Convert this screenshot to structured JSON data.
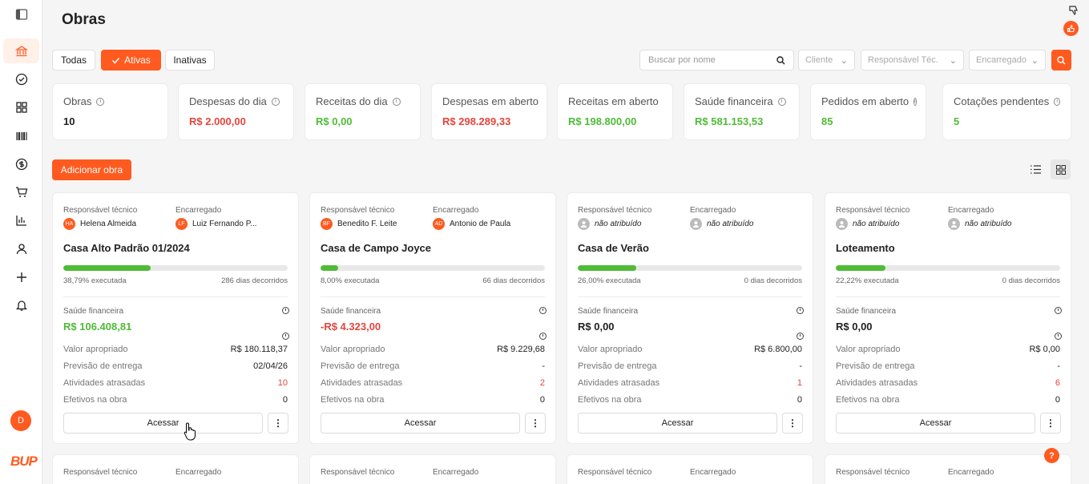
{
  "page": {
    "title": "Obras"
  },
  "colors": {
    "accent": "#ff5a1f",
    "positive": "#4fbb37",
    "negative": "#e4453c"
  },
  "sidebar": {
    "avatar_initial": "D",
    "logo": "BUP",
    "items": [
      {
        "icon": "bank-icon",
        "active": true
      },
      {
        "icon": "check-circle-icon"
      },
      {
        "icon": "grid-icon"
      },
      {
        "icon": "barcode-icon"
      },
      {
        "icon": "dollar-icon"
      },
      {
        "icon": "cart-icon"
      },
      {
        "icon": "bar-chart-icon"
      },
      {
        "icon": "user-icon"
      },
      {
        "icon": "plus-icon"
      },
      {
        "icon": "bell-icon"
      }
    ]
  },
  "filters": {
    "status": [
      "Todas",
      "Ativas",
      "Inativas"
    ],
    "selected": "Ativas",
    "search_placeholder": "Buscar por nome",
    "selects": [
      "Cliente",
      "Responsável Téc.",
      "Encarregado"
    ]
  },
  "stats": [
    {
      "label": "Obras",
      "value": "10",
      "tone": "dark",
      "info": true
    },
    {
      "label": "Despesas do dia",
      "value": "R$ 2.000,00",
      "tone": "red",
      "info": true
    },
    {
      "label": "Receitas do dia",
      "value": "R$ 0,00",
      "tone": "green",
      "info": true
    },
    {
      "label": "Despesas em aberto",
      "value": "R$ 298.289,33",
      "tone": "red",
      "info": false
    },
    {
      "label": "Receitas em aberto",
      "value": "R$ 198.800,00",
      "tone": "green",
      "info": false
    },
    {
      "label": "Saúde financeira",
      "value": "R$ 581.153,53",
      "tone": "green",
      "info": true
    },
    {
      "label": "Pedidos em aberto",
      "value": "85",
      "tone": "green",
      "info": true
    },
    {
      "label": "Cotações pendentes",
      "value": "5",
      "tone": "green",
      "info": true
    }
  ],
  "actions": {
    "add_label": "Adicionar obra"
  },
  "card_labels": {
    "responsavel": "Responsável técnico",
    "encarregado": "Encarregado",
    "saude": "Saúde financeira",
    "valor": "Valor apropriado",
    "previsao": "Previsão de entrega",
    "atividades": "Atividades atrasadas",
    "efetivos": "Efetivos na obra",
    "acessar": "Acessar"
  },
  "cards": [
    {
      "resp": {
        "initials": "HA",
        "name": "Helena Almeida"
      },
      "enc": {
        "initials": "LF",
        "name": "Luiz Fernando P..."
      },
      "name": "Casa Alto Padrão 01/2024",
      "progress": 0.3879,
      "exec": "38,79% executada",
      "dias": "286 dias decorridos",
      "saude": "R$ 106.408,81",
      "saude_tone": "green",
      "valor": "R$ 180.118,37",
      "previsao": "02/04/26",
      "atividades": "10",
      "efetivos": "0"
    },
    {
      "resp": {
        "initials": "BF",
        "name": "Benedito F. Leite"
      },
      "enc": {
        "initials": "AD",
        "name": "Antonio de Paula"
      },
      "name": "Casa de Campo Joyce",
      "progress": 0.08,
      "exec": "8,00% executada",
      "dias": "66 dias decorridos",
      "saude": "-R$ 4.323,00",
      "saude_tone": "red",
      "valor": "R$ 9.229,68",
      "previsao": "-",
      "atividades": "2",
      "efetivos": "0"
    },
    {
      "resp": {
        "initials": "",
        "name": "não atribuído",
        "none": true
      },
      "enc": {
        "initials": "",
        "name": "não atribuído",
        "none": true
      },
      "name": "Casa de Verão",
      "progress": 0.26,
      "exec": "26,00% executada",
      "dias": "0 dias decorridos",
      "saude": "R$ 0,00",
      "saude_tone": "dark",
      "valor": "R$ 6.800,00",
      "previsao": "-",
      "atividades": "1",
      "efetivos": "0"
    },
    {
      "resp": {
        "initials": "",
        "name": "não atribuído",
        "none": true
      },
      "enc": {
        "initials": "",
        "name": "não atribuído",
        "none": true
      },
      "name": "Loteamento",
      "progress": 0.2222,
      "exec": "22,22% executada",
      "dias": "0 dias decorridos",
      "saude": "R$ 0,00",
      "saude_tone": "dark",
      "valor": "R$ 0,00",
      "previsao": "-",
      "atividades": "6",
      "efetivos": "0"
    }
  ],
  "help_label": "?"
}
